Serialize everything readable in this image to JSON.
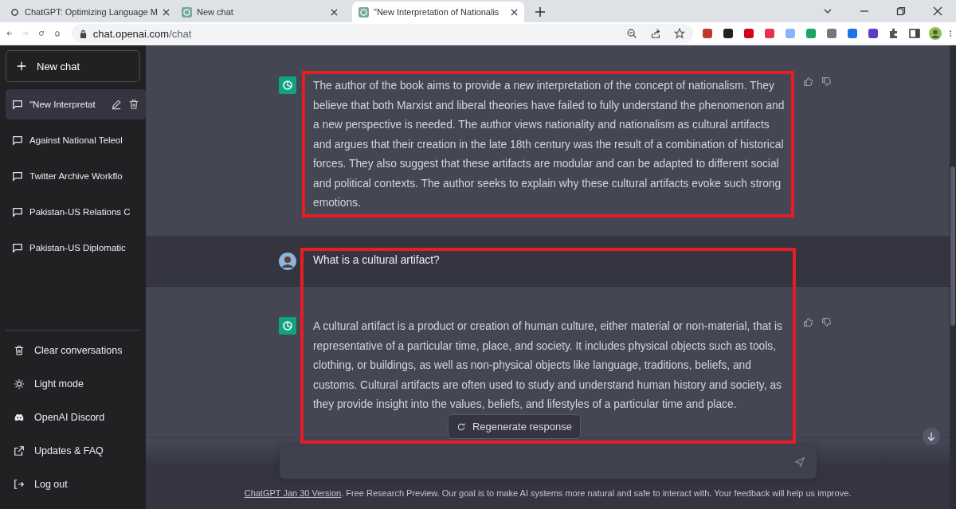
{
  "browser": {
    "tabs": [
      {
        "title": "ChatGPT: Optimizing Language M",
        "selected": false
      },
      {
        "title": "New chat",
        "selected": false
      },
      {
        "title": "\"New Interpretation of Nationalis",
        "selected": true
      }
    ],
    "url_host": "chat.openai.com",
    "url_path": "/chat"
  },
  "sidebar": {
    "new_chat": "New chat",
    "conversations": [
      {
        "title": "\"New Interpretat",
        "selected": true
      },
      {
        "title": "Against National Teleol",
        "selected": false
      },
      {
        "title": "Twitter Archive Workflo",
        "selected": false
      },
      {
        "title": "Pakistan-US Relations C",
        "selected": false
      },
      {
        "title": "Pakistan-US Diplomatic",
        "selected": false
      }
    ],
    "menu": [
      {
        "kind": "trash",
        "label": "Clear conversations"
      },
      {
        "kind": "sun",
        "label": "Light mode"
      },
      {
        "kind": "discord",
        "label": "OpenAI Discord"
      },
      {
        "kind": "external",
        "label": "Updates & FAQ"
      },
      {
        "kind": "logout",
        "label": "Log out"
      }
    ]
  },
  "blocks": [
    {
      "framed": true,
      "messages": [
        {
          "kind": "assistant",
          "text": "The author of the book aims to provide a new interpretation of the concept of nationalism. They believe that both Marxist and liberal theories have failed to fully understand the phenomenon and a new perspective is needed. The author views nationality and nationalism as cultural artifacts and argues that their creation in the late 18th century was the result of a combination of historical forces. They also suggest that these artifacts are modular and can be adapted to different social and political contexts. The author seeks to explain why these cultural artifacts evoke such strong emotions."
        }
      ]
    },
    {
      "framed": true,
      "messages": [
        {
          "kind": "user",
          "text": "What is a cultural artifact?"
        },
        {
          "kind": "assistant",
          "text": "A cultural artifact is a product or creation of human culture, either material or non-material, that is representative of a particular time, place, and society. It includes physical objects such as tools, clothing, or buildings, as well as non-physical objects like language, traditions, beliefs, and customs. Cultural artifacts are often used to study and understand human history and society, as they provide insight into the values, beliefs, and lifestyles of a particular time and place."
        }
      ]
    }
  ],
  "regenerate": "Regenerate response",
  "footer": {
    "link": "ChatGPT Jan 30 Version",
    "text": ". Free Research Preview. Our goal is to make AI systems more natural and safe to interact with. Your feedback will help us improve."
  }
}
